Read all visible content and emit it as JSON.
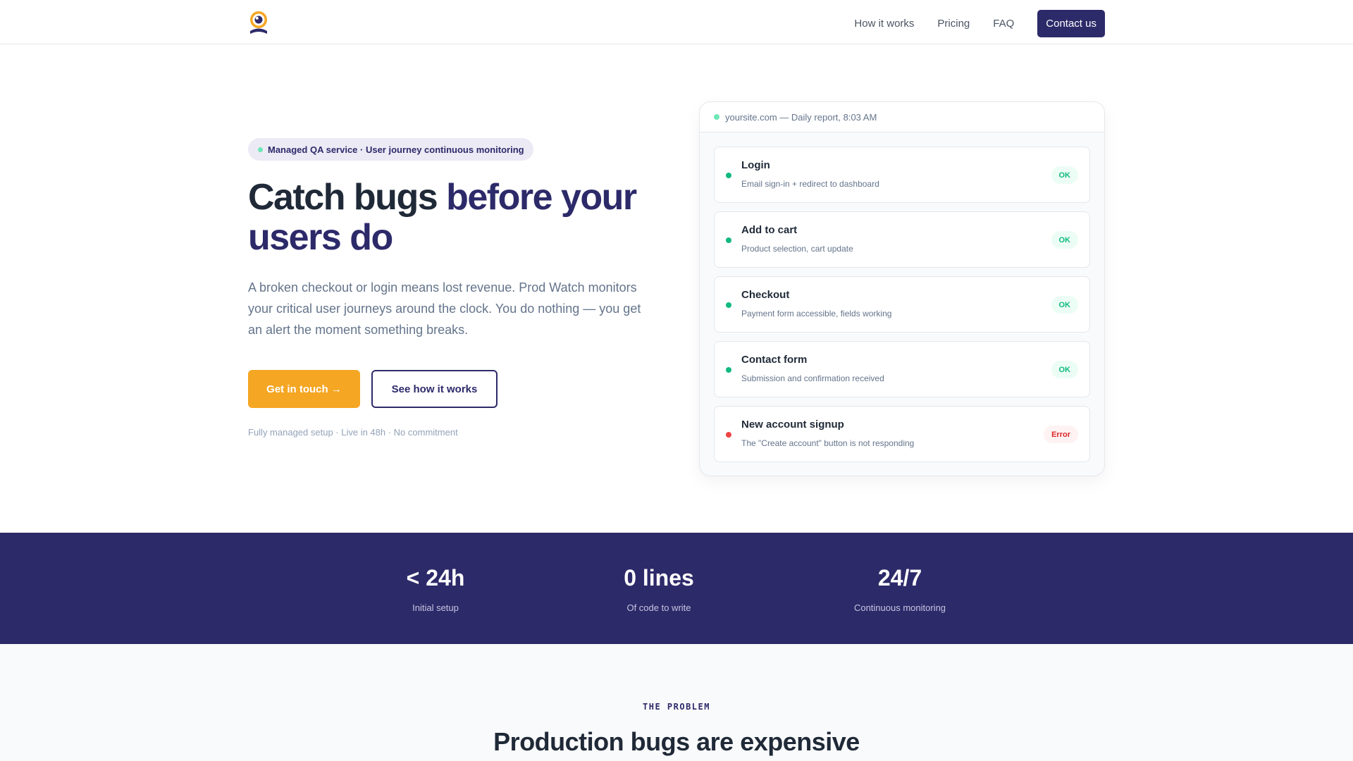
{
  "nav": {
    "links": [
      "How it works",
      "Pricing",
      "FAQ"
    ],
    "cta": "Contact us"
  },
  "hero": {
    "badge": "Managed QA service · User journey continuous monitoring",
    "title_part1": "Catch bugs ",
    "title_accent": "before your users do",
    "description": "A broken checkout or login means lost revenue. Prod Watch monitors your critical user journeys around the clock. You do nothing — you get an alert the moment something breaks.",
    "primary_cta": "Get in touch →",
    "secondary_cta": "See how it works",
    "note": "Fully managed setup · Live in 48h · No commitment"
  },
  "report": {
    "header": "yoursite.com — Daily report, 8:03 AM",
    "rows": [
      {
        "title": "Login",
        "desc": "Email sign-in + redirect to dashboard",
        "status": "OK"
      },
      {
        "title": "Add to cart",
        "desc": "Product selection, cart update",
        "status": "OK"
      },
      {
        "title": "Checkout",
        "desc": "Payment form accessible, fields working",
        "status": "OK"
      },
      {
        "title": "Contact form",
        "desc": "Submission and confirmation received",
        "status": "OK"
      },
      {
        "title": "New account signup",
        "desc": "The \"Create account\" button is not responding",
        "status": "Error"
      }
    ]
  },
  "stats": [
    {
      "value": "< 24h",
      "label": "Initial setup"
    },
    {
      "value": "0 lines",
      "label": "Of code to write"
    },
    {
      "value": "24/7",
      "label": "Continuous monitoring"
    }
  ],
  "problem": {
    "eyebrow": "THE PROBLEM",
    "title": "Production bugs are expensive"
  },
  "colors": {
    "brand": "#2d2a6a",
    "accent": "#f5a623",
    "ok": "#10b981",
    "error": "#ef4444"
  },
  "icons": {
    "logo": "eye-logo-icon",
    "status_dot": "status-dot-icon"
  }
}
